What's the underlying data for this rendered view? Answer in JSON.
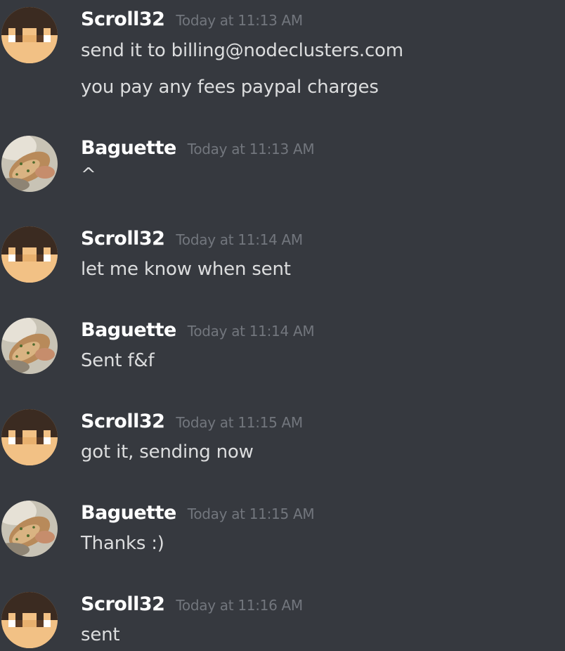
{
  "messages": [
    {
      "author": "Scroll32",
      "avatar_icon": "minecraft-face-avatar-icon",
      "timestamp": "Today at 11:13 AM",
      "lines": [
        "send it to billing@nodeclusters.com",
        "you pay any fees paypal charges"
      ]
    },
    {
      "author": "Baguette",
      "avatar_icon": "bread-photo-avatar-icon",
      "timestamp": "Today at 11:13 AM",
      "lines": [
        "^"
      ]
    },
    {
      "author": "Scroll32",
      "avatar_icon": "minecraft-face-avatar-icon",
      "timestamp": "Today at 11:14 AM",
      "lines": [
        "let me know when sent"
      ]
    },
    {
      "author": "Baguette",
      "avatar_icon": "bread-photo-avatar-icon",
      "timestamp": "Today at 11:14 AM",
      "lines": [
        "Sent f&f"
      ]
    },
    {
      "author": "Scroll32",
      "avatar_icon": "minecraft-face-avatar-icon",
      "timestamp": "Today at 11:15 AM",
      "lines": [
        "got it, sending now"
      ]
    },
    {
      "author": "Baguette",
      "avatar_icon": "bread-photo-avatar-icon",
      "timestamp": "Today at 11:15 AM",
      "lines": [
        "Thanks :)"
      ]
    },
    {
      "author": "Scroll32",
      "avatar_icon": "minecraft-face-avatar-icon",
      "timestamp": "Today at 11:16 AM",
      "lines": [
        "sent"
      ]
    }
  ],
  "colors": {
    "background": "#36393f",
    "username": "#ffffff",
    "timestamp": "#72767d",
    "message_text": "#dcddde"
  }
}
